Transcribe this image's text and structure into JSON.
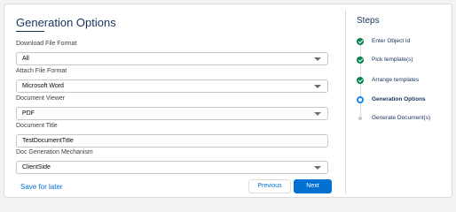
{
  "form": {
    "title": "Generation Options",
    "fields": {
      "download_format": {
        "label": "Download File Format",
        "value": "All"
      },
      "attach_format": {
        "label": "Attach File Format",
        "value": "Microsoft Word"
      },
      "document_viewer": {
        "label": "Document Viewer",
        "value": "PDF"
      },
      "document_title": {
        "label": "Document Title",
        "value": "TestDocumentTitle"
      },
      "doc_generation": {
        "label": "Doc Generation Mechanism",
        "value": "ClientSide"
      }
    }
  },
  "footer": {
    "save_later": "Save for later",
    "previous": "Previous",
    "next": "Next"
  },
  "steps": {
    "title": "Steps",
    "items": [
      {
        "label": "Enter Object Id",
        "status": "done"
      },
      {
        "label": "Pick template(s)",
        "status": "done"
      },
      {
        "label": "Arrange templates",
        "status": "done"
      },
      {
        "label": "Generation Options",
        "status": "active"
      },
      {
        "label": "Generate Document(s)",
        "status": "pending"
      }
    ]
  },
  "colors": {
    "brand": "#0070d2",
    "heading": "#16325c",
    "success": "#04844b",
    "active_step": "#1589ee"
  }
}
